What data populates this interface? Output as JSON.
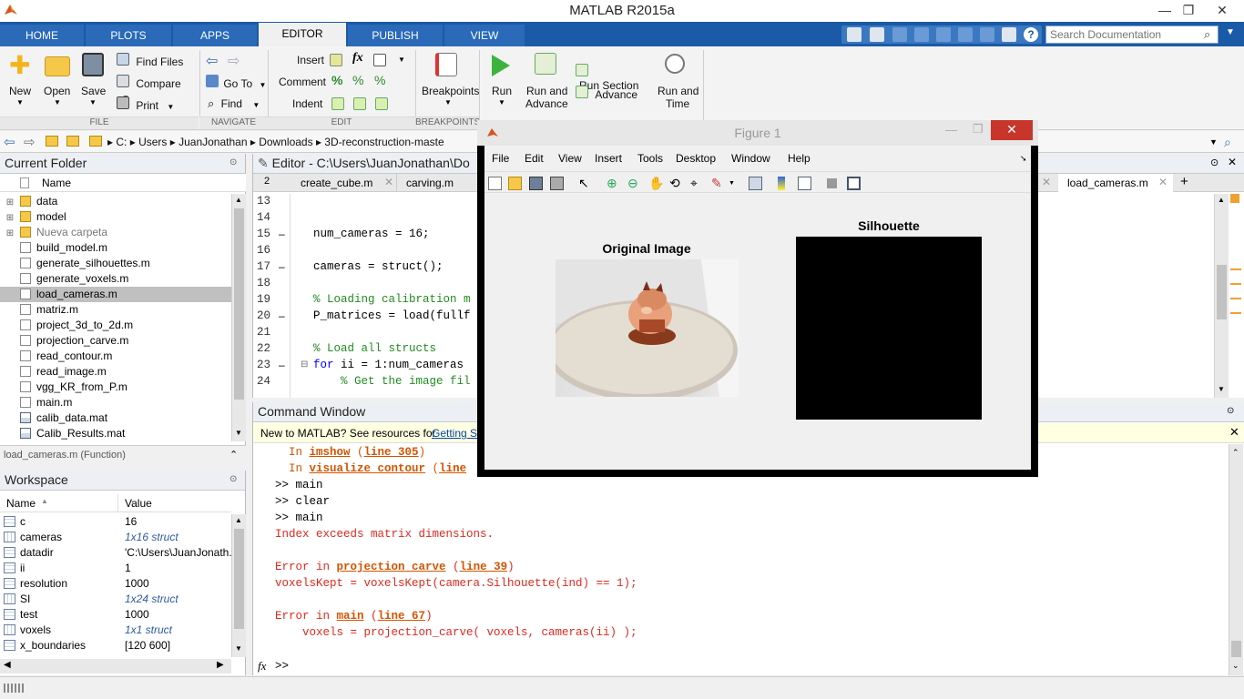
{
  "app_title": "MATLAB R2015a",
  "tabs": [
    {
      "label": "HOME"
    },
    {
      "label": "PLOTS"
    },
    {
      "label": "APPS"
    },
    {
      "label": "EDITOR"
    },
    {
      "label": "PUBLISH"
    },
    {
      "label": "VIEW"
    }
  ],
  "search_placeholder": "Search Documentation",
  "ribbon": {
    "new": "New",
    "open": "Open",
    "save": "Save",
    "find_files": "Find Files",
    "compare": "Compare",
    "print": "Print",
    "go_to": "Go To",
    "find": "Find",
    "insert": "Insert",
    "comment": "Comment",
    "indent": "Indent",
    "breakpoints": "Breakpoints",
    "run": "Run",
    "run_and_advance_1": "Run and",
    "run_and_advance_2": "Advance",
    "run_section": "Run Section",
    "advance": "Advance",
    "run_and_time_1": "Run and",
    "run_and_time_2": "Time",
    "sections": [
      "FILE",
      "NAVIGATE",
      "EDIT",
      "BREAKPOINTS"
    ]
  },
  "path": [
    "C:",
    "Users",
    "JuanJonathan",
    "Downloads",
    "3D-reconstruction-maste"
  ],
  "current_folder": {
    "title": "Current Folder",
    "col_name": "Name",
    "items": [
      {
        "name": "data",
        "type": "folder"
      },
      {
        "name": "model",
        "type": "folder"
      },
      {
        "name": "Nueva carpeta",
        "type": "folder"
      },
      {
        "name": "build_model.m",
        "type": "m"
      },
      {
        "name": "generate_silhouettes.m",
        "type": "fn"
      },
      {
        "name": "generate_voxels.m",
        "type": "fn"
      },
      {
        "name": "load_cameras.m",
        "type": "fn"
      },
      {
        "name": "matriz.m",
        "type": "fn"
      },
      {
        "name": "project_3d_to_2d.m",
        "type": "fn"
      },
      {
        "name": "projection_carve.m",
        "type": "fn"
      },
      {
        "name": "read_contour.m",
        "type": "fn"
      },
      {
        "name": "read_image.m",
        "type": "fn"
      },
      {
        "name": "vgg_KR_from_P.m",
        "type": "fn"
      },
      {
        "name": "main.m",
        "type": "m"
      },
      {
        "name": "calib_data.mat",
        "type": "mat"
      },
      {
        "name": "Calib_Results.mat",
        "type": "mat"
      }
    ],
    "details": "load_cameras.m (Function)"
  },
  "workspace": {
    "title": "Workspace",
    "col_name": "Name",
    "col_value": "Value",
    "rows": [
      {
        "name": "c",
        "value": "16",
        "struct": false
      },
      {
        "name": "cameras",
        "value": "1x16 struct",
        "struct": true
      },
      {
        "name": "datadir",
        "value": "'C:\\Users\\JuanJonath...",
        "struct": false
      },
      {
        "name": "ii",
        "value": "1",
        "struct": false
      },
      {
        "name": "resolution",
        "value": "1000",
        "struct": false
      },
      {
        "name": "SI",
        "value": "1x24 struct",
        "struct": true
      },
      {
        "name": "test",
        "value": "1000",
        "struct": false
      },
      {
        "name": "voxels",
        "value": "1x1 struct",
        "struct": true
      },
      {
        "name": "x_boundaries",
        "value": "[120 600]",
        "struct": false
      }
    ]
  },
  "editor": {
    "title": "Editor - C:\\Users\\JuanJonathan\\Do",
    "tab_count": "2",
    "tabs": [
      "create_cube.m",
      "carving.m"
    ],
    "right_tab": "load_cameras.m",
    "lines": [
      {
        "n": "13",
        "dash": false,
        "code": ""
      },
      {
        "n": "14",
        "dash": false,
        "code": ""
      },
      {
        "n": "15",
        "dash": true,
        "code": "num_cameras = 16;"
      },
      {
        "n": "16",
        "dash": false,
        "code": ""
      },
      {
        "n": "17",
        "dash": true,
        "code": "cameras = struct();"
      },
      {
        "n": "18",
        "dash": false,
        "code": ""
      },
      {
        "n": "19",
        "dash": false,
        "code": "% Loading calibration m"
      },
      {
        "n": "20",
        "dash": true,
        "code": "P_matrices = load(fullf"
      },
      {
        "n": "21",
        "dash": false,
        "code": ""
      },
      {
        "n": "22",
        "dash": false,
        "code": "% Load all structs"
      },
      {
        "n": "23",
        "dash": true,
        "code": "for ii = 1:num_cameras"
      },
      {
        "n": "24",
        "dash": false,
        "code": "    % Get the image fil"
      }
    ],
    "for_kw": "for",
    "for_rest": " ii = 1:num_cameras"
  },
  "command_window": {
    "title": "Command Window",
    "notice_text": "New to MATLAB? See resources for ",
    "notice_link": "Getting St",
    "lines": [
      {
        "kind": "warn1",
        "pre": "  In ",
        "link": "imshow",
        "mid": " (",
        "link2": "line 305",
        "post": ")"
      },
      {
        "kind": "warn2",
        "pre": "  In ",
        "link": "visualize_contour",
        "mid": " (",
        "link2": "line",
        "post": ""
      },
      {
        "kind": "plain",
        "text": ">> main"
      },
      {
        "kind": "plain",
        "text": ">> clear"
      },
      {
        "kind": "plain",
        "text": ">> main"
      },
      {
        "kind": "errtext",
        "text": "Index exceeds matrix dimensions."
      },
      {
        "kind": "blank",
        "text": ""
      },
      {
        "kind": "errlink",
        "pre": "Error in ",
        "link": "projection_carve",
        "mid": " (",
        "link2": "line 39",
        "post": ")"
      },
      {
        "kind": "errtext",
        "text": "voxelsKept = voxelsKept(camera.Silhouette(ind) == 1);"
      },
      {
        "kind": "blank",
        "text": ""
      },
      {
        "kind": "errlink",
        "pre": "Error in ",
        "link": "main",
        "mid": " (",
        "link2": "line 67",
        "post": ")"
      },
      {
        "kind": "errtext",
        "text": "    voxels = projection_carve( voxels, cameras(ii) );"
      }
    ],
    "prompt": ">>",
    "fx": "fx"
  },
  "figure": {
    "title": "Figure 1",
    "menus": [
      "File",
      "Edit",
      "View",
      "Insert",
      "Tools",
      "Desktop",
      "Window",
      "Help"
    ],
    "axes1_title": "Original Image",
    "axes2_title": "Silhouette"
  }
}
